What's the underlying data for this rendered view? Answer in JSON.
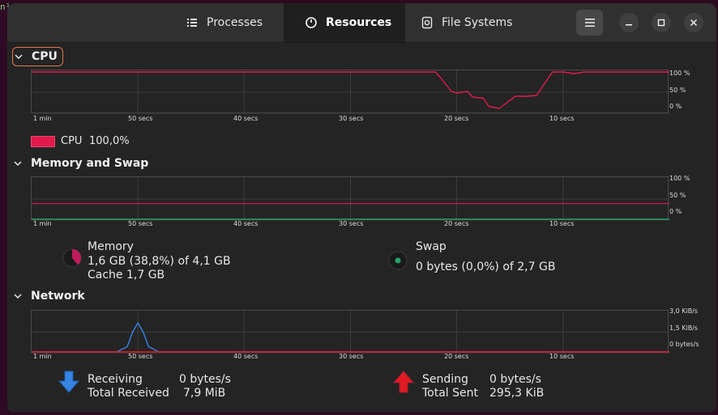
{
  "tabs": [
    {
      "label": "Processes",
      "icon": "processes-list-icon"
    },
    {
      "label": "Resources",
      "icon": "resources-gauge-icon"
    },
    {
      "label": "File Systems",
      "icon": "disk-icon"
    }
  ],
  "colors": {
    "cpu": "#e01b4b",
    "memory": "#c01c5c",
    "swap": "#26a269",
    "receiving": "#3584e4",
    "sending": "#e01b24",
    "grid": "#3d3d3d"
  },
  "x_ticks": [
    "1 min",
    "50 secs",
    "40 secs",
    "30 secs",
    "20 secs",
    "10 secs"
  ],
  "cpu": {
    "title": "CPU",
    "y_ticks": [
      "100 %",
      "50 %",
      "0 %"
    ],
    "legend_label": "CPU",
    "legend_value": "100,0%",
    "history_seconds_ago": [
      60,
      50,
      40,
      30,
      22,
      21.5,
      20.5,
      20,
      19,
      18.5,
      17.5,
      17,
      16,
      15.5,
      14.5,
      13.5,
      12.5,
      11,
      10,
      9,
      8,
      6,
      4,
      2,
      0
    ],
    "history_percent": [
      100,
      100,
      100,
      100,
      100,
      85,
      52,
      48,
      52,
      38,
      35,
      15,
      10,
      20,
      40,
      40,
      42,
      100,
      100,
      96,
      100,
      100,
      100,
      100,
      100
    ]
  },
  "memory": {
    "title": "Memory and Swap",
    "y_ticks": [
      "100 %",
      "50 %",
      "0 %"
    ],
    "memory_label": "Memory",
    "memory_used": "1,6 GB (38,8%) of 4,1 GB",
    "memory_cache": "Cache 1,7 GB",
    "memory_percent": 38.8,
    "swap_label": "Swap",
    "swap_used": "0 bytes (0,0%) of 2,7 GB",
    "swap_percent": 0.0
  },
  "network": {
    "title": "Network",
    "y_ticks": [
      "3,0 KiB/s",
      "1,5 KiB/s",
      "0 bytes/s"
    ],
    "receiving_label": "Receiving",
    "receiving_value": "0 bytes/s",
    "total_received_label": "Total Received",
    "total_received_value": "7,9 MiB",
    "sending_label": "Sending",
    "sending_value": "0 bytes/s",
    "total_sent_label": "Total Sent",
    "total_sent_value": "295,3 KiB",
    "receiving_history_seconds_ago": [
      60,
      52,
      51,
      50.5,
      50,
      49.5,
      49,
      48,
      0
    ],
    "receiving_history_kib": [
      0,
      0,
      0.4,
      1.5,
      2.2,
      1.5,
      0.4,
      0,
      0
    ]
  }
}
